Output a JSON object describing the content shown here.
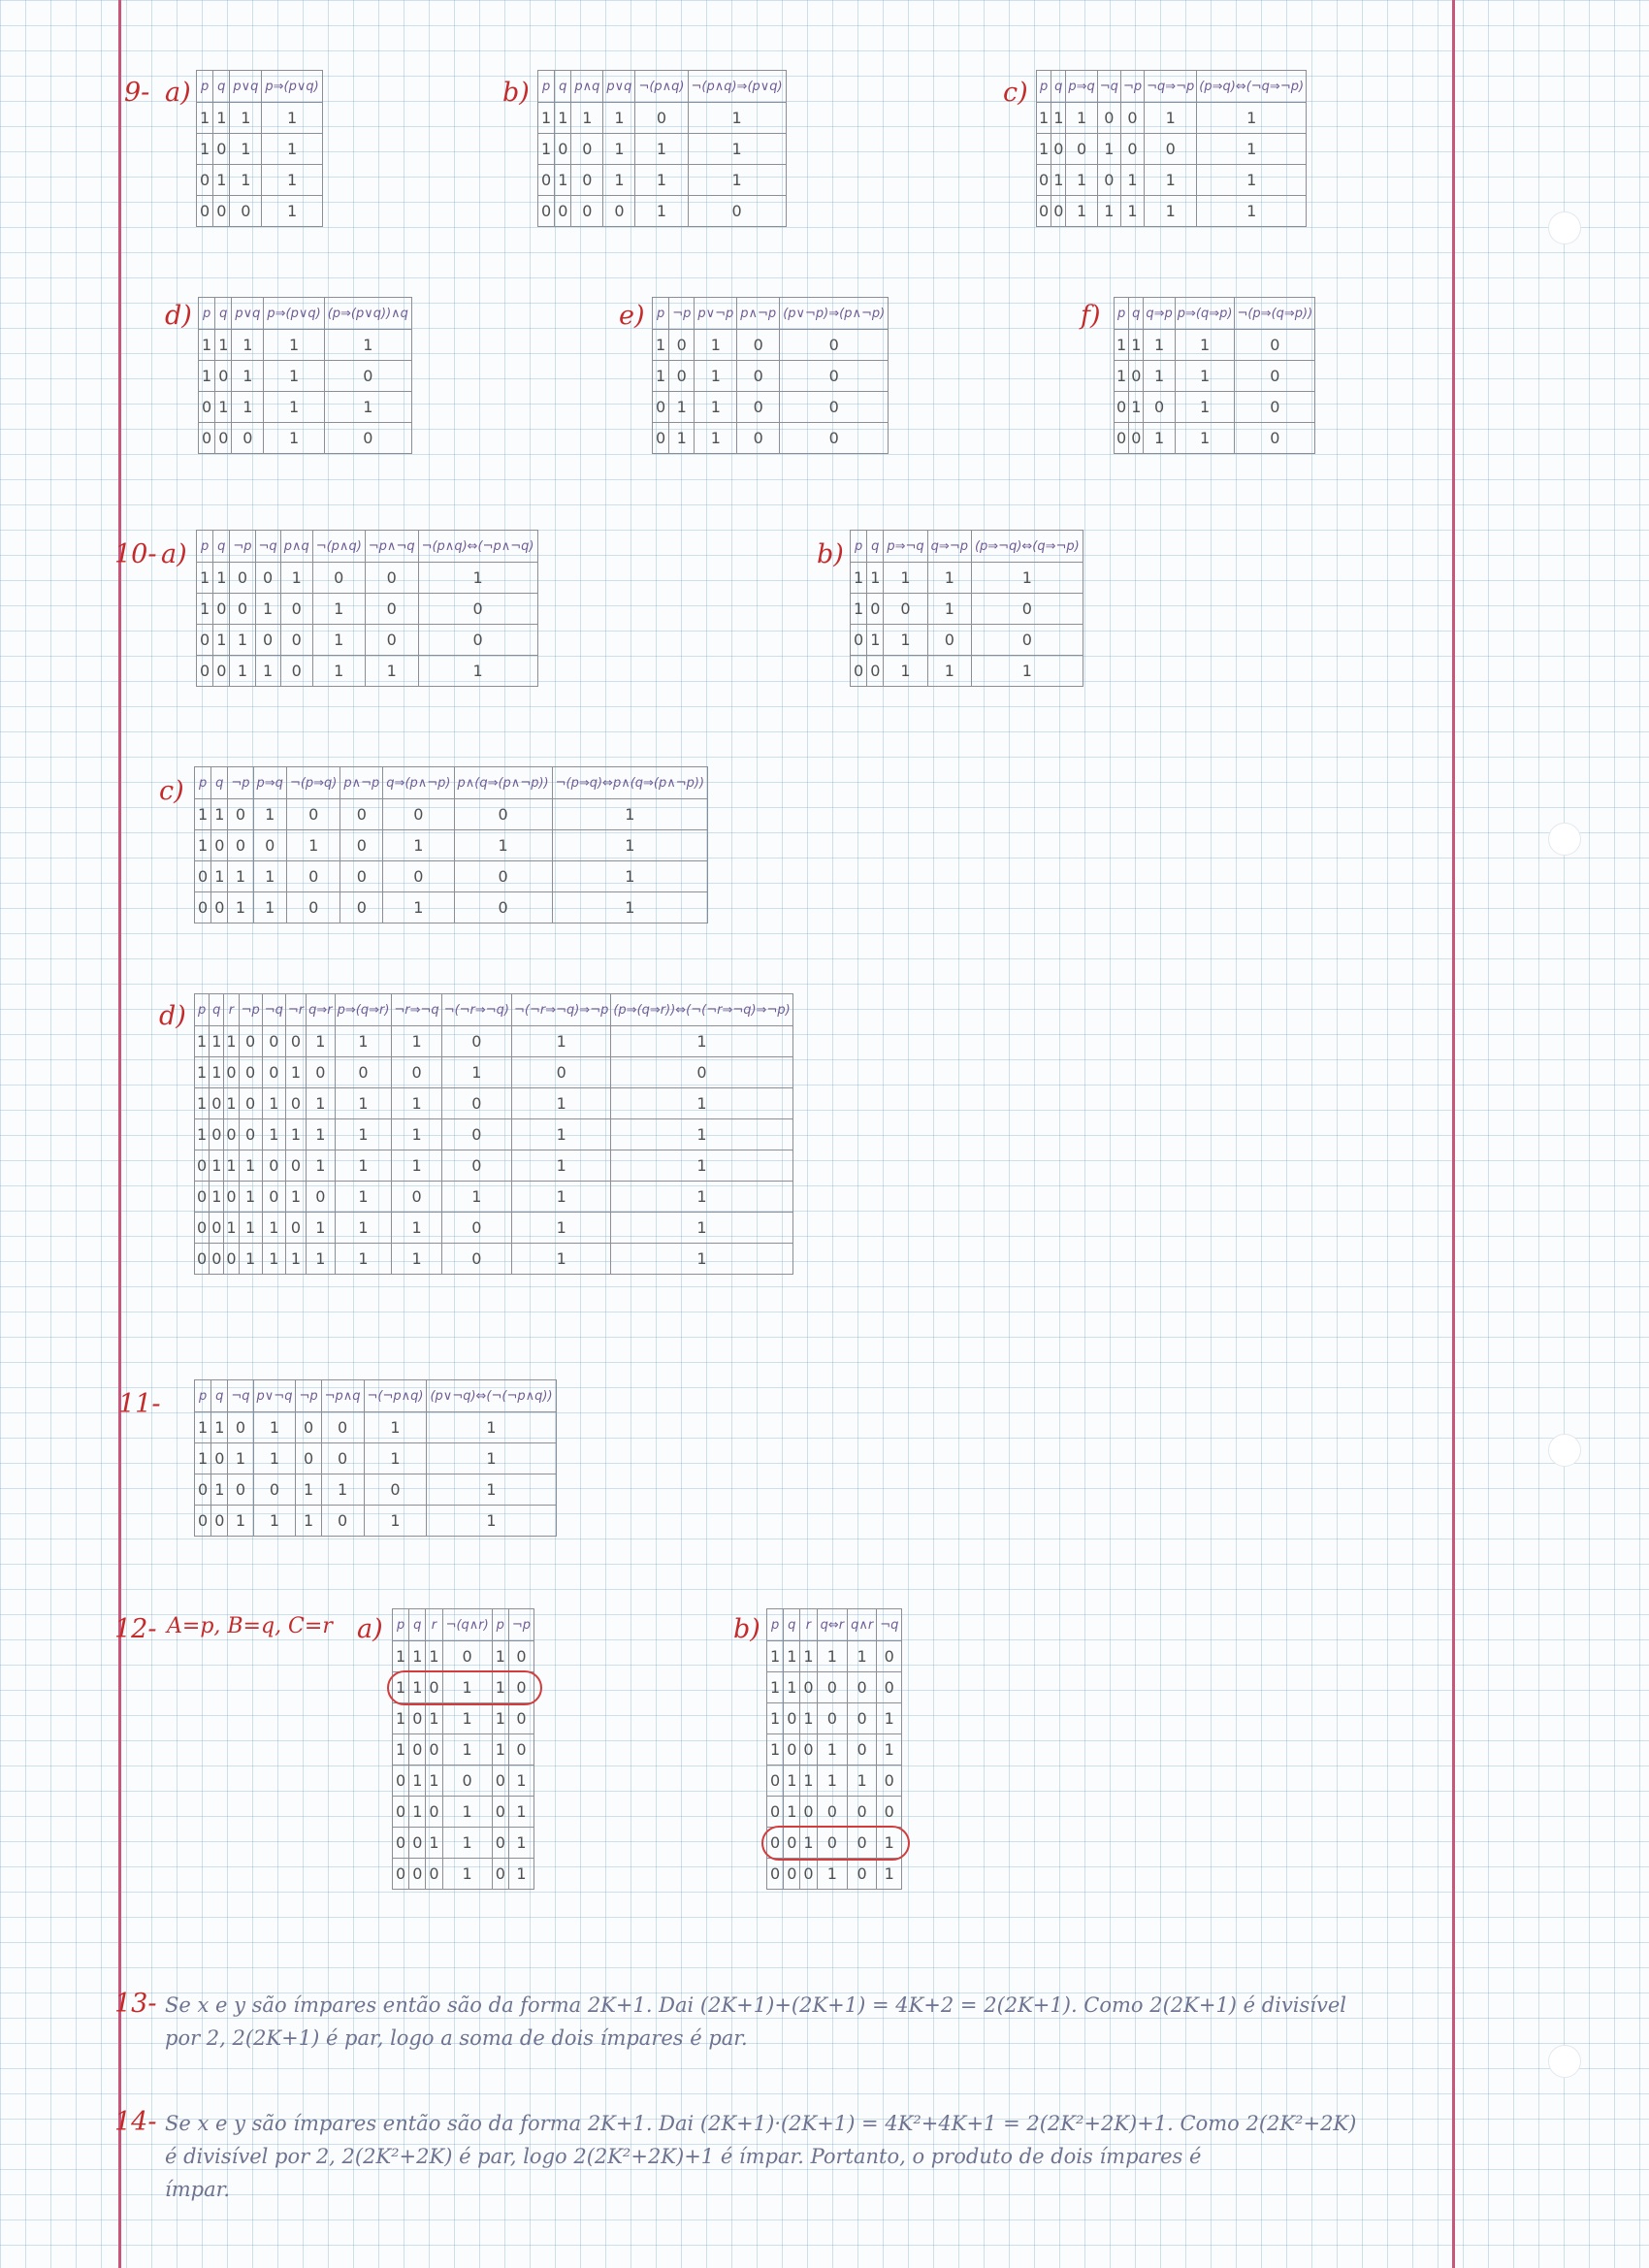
{
  "ex9": {
    "label": "9-",
    "a": {
      "label": "a)",
      "headers": [
        "p",
        "q",
        "p∨q",
        "p⇒(p∨q)"
      ],
      "rows": [
        [
          "1",
          "1",
          "1",
          "1"
        ],
        [
          "1",
          "0",
          "1",
          "1"
        ],
        [
          "0",
          "1",
          "1",
          "1"
        ],
        [
          "0",
          "0",
          "0",
          "1"
        ]
      ]
    },
    "b": {
      "label": "b)",
      "headers": [
        "p",
        "q",
        "p∧q",
        "p∨q",
        "¬(p∧q)",
        "¬(p∧q)⇒(p∨q)"
      ],
      "rows": [
        [
          "1",
          "1",
          "1",
          "1",
          "0",
          "1"
        ],
        [
          "1",
          "0",
          "0",
          "1",
          "1",
          "1"
        ],
        [
          "0",
          "1",
          "0",
          "1",
          "1",
          "1"
        ],
        [
          "0",
          "0",
          "0",
          "0",
          "1",
          "0"
        ]
      ]
    },
    "c": {
      "label": "c)",
      "headers": [
        "p",
        "q",
        "p⇒q",
        "¬q",
        "¬p",
        "¬q⇒¬p",
        "(p⇒q)⇔(¬q⇒¬p)"
      ],
      "rows": [
        [
          "1",
          "1",
          "1",
          "0",
          "0",
          "1",
          "1"
        ],
        [
          "1",
          "0",
          "0",
          "1",
          "0",
          "0",
          "1"
        ],
        [
          "0",
          "1",
          "1",
          "0",
          "1",
          "1",
          "1"
        ],
        [
          "0",
          "0",
          "1",
          "1",
          "1",
          "1",
          "1"
        ]
      ]
    },
    "d": {
      "label": "d)",
      "headers": [
        "p",
        "q",
        "p∨q",
        "p⇒(p∨q)",
        "(p⇒(p∨q))∧q"
      ],
      "rows": [
        [
          "1",
          "1",
          "1",
          "1",
          "1"
        ],
        [
          "1",
          "0",
          "1",
          "1",
          "0"
        ],
        [
          "0",
          "1",
          "1",
          "1",
          "1"
        ],
        [
          "0",
          "0",
          "0",
          "1",
          "0"
        ]
      ]
    },
    "e": {
      "label": "e)",
      "headers": [
        "p",
        "¬p",
        "p∨¬p",
        "p∧¬p",
        "(p∨¬p)⇒(p∧¬p)"
      ],
      "rows": [
        [
          "1",
          "0",
          "1",
          "0",
          "0"
        ],
        [
          "1",
          "0",
          "1",
          "0",
          "0"
        ],
        [
          "0",
          "1",
          "1",
          "0",
          "0"
        ],
        [
          "0",
          "1",
          "1",
          "0",
          "0"
        ]
      ]
    },
    "f": {
      "label": "f)",
      "headers": [
        "p",
        "q",
        "q⇒p",
        "p⇒(q⇒p)",
        "¬(p⇒(q⇒p))"
      ],
      "rows": [
        [
          "1",
          "1",
          "1",
          "1",
          "0"
        ],
        [
          "1",
          "0",
          "1",
          "1",
          "0"
        ],
        [
          "0",
          "1",
          "0",
          "1",
          "0"
        ],
        [
          "0",
          "0",
          "1",
          "1",
          "0"
        ]
      ]
    }
  },
  "ex10": {
    "label": "10-",
    "a": {
      "label": "a)",
      "headers": [
        "p",
        "q",
        "¬p",
        "¬q",
        "p∧q",
        "¬(p∧q)",
        "¬p∧¬q",
        "¬(p∧q)⇔(¬p∧¬q)"
      ],
      "rows": [
        [
          "1",
          "1",
          "0",
          "0",
          "1",
          "0",
          "0",
          "1"
        ],
        [
          "1",
          "0",
          "0",
          "1",
          "0",
          "1",
          "0",
          "0"
        ],
        [
          "0",
          "1",
          "1",
          "0",
          "0",
          "1",
          "0",
          "0"
        ],
        [
          "0",
          "0",
          "1",
          "1",
          "0",
          "1",
          "1",
          "1"
        ]
      ]
    },
    "b": {
      "label": "b)",
      "headers": [
        "p",
        "q",
        "p⇒¬q",
        "q⇒¬p",
        "(p⇒¬q)⇔(q⇒¬p)"
      ],
      "rows": [
        [
          "1",
          "1",
          "1",
          "1",
          "1"
        ],
        [
          "1",
          "0",
          "0",
          "1",
          "0"
        ],
        [
          "0",
          "1",
          "1",
          "0",
          "0"
        ],
        [
          "0",
          "0",
          "1",
          "1",
          "1"
        ]
      ]
    },
    "c": {
      "label": "c)",
      "headers": [
        "p",
        "q",
        "¬p",
        "p⇒q",
        "¬(p⇒q)",
        "p∧¬p",
        "q⇒(p∧¬p)",
        "p∧(q⇒(p∧¬p))",
        "¬(p⇒q)⇔p∧(q⇒(p∧¬p))"
      ],
      "rows": [
        [
          "1",
          "1",
          "0",
          "1",
          "0",
          "0",
          "0",
          "0",
          "1"
        ],
        [
          "1",
          "0",
          "0",
          "0",
          "1",
          "0",
          "1",
          "1",
          "1"
        ],
        [
          "0",
          "1",
          "1",
          "1",
          "0",
          "0",
          "0",
          "0",
          "1"
        ],
        [
          "0",
          "0",
          "1",
          "1",
          "0",
          "0",
          "1",
          "0",
          "1"
        ]
      ]
    },
    "d": {
      "label": "d)",
      "headers": [
        "p",
        "q",
        "r",
        "¬p",
        "¬q",
        "¬r",
        "q⇒r",
        "p⇒(q⇒r)",
        "¬r⇒¬q",
        "¬(¬r⇒¬q)",
        "¬(¬r⇒¬q)⇒¬p",
        "(p⇒(q⇒r))⇔(¬(¬r⇒¬q)⇒¬p)"
      ],
      "rows": [
        [
          "1",
          "1",
          "1",
          "0",
          "0",
          "0",
          "1",
          "1",
          "1",
          "0",
          "1",
          "1"
        ],
        [
          "1",
          "1",
          "0",
          "0",
          "0",
          "1",
          "0",
          "0",
          "0",
          "1",
          "0",
          "0"
        ],
        [
          "1",
          "0",
          "1",
          "0",
          "1",
          "0",
          "1",
          "1",
          "1",
          "0",
          "1",
          "1"
        ],
        [
          "1",
          "0",
          "0",
          "0",
          "1",
          "1",
          "1",
          "1",
          "1",
          "0",
          "1",
          "1"
        ],
        [
          "0",
          "1",
          "1",
          "1",
          "0",
          "0",
          "1",
          "1",
          "1",
          "0",
          "1",
          "1"
        ],
        [
          "0",
          "1",
          "0",
          "1",
          "0",
          "1",
          "0",
          "1",
          "0",
          "1",
          "1",
          "1"
        ],
        [
          "0",
          "0",
          "1",
          "1",
          "1",
          "0",
          "1",
          "1",
          "1",
          "0",
          "1",
          "1"
        ],
        [
          "0",
          "0",
          "0",
          "1",
          "1",
          "1",
          "1",
          "1",
          "1",
          "0",
          "1",
          "1"
        ]
      ]
    }
  },
  "ex11": {
    "label": "11-",
    "headers": [
      "p",
      "q",
      "¬q",
      "p∨¬q",
      "¬p",
      "¬p∧q",
      "¬(¬p∧q)",
      "(p∨¬q)⇔(¬(¬p∧q))"
    ],
    "rows": [
      [
        "1",
        "1",
        "0",
        "1",
        "0",
        "0",
        "1",
        "1"
      ],
      [
        "1",
        "0",
        "1",
        "1",
        "0",
        "0",
        "1",
        "1"
      ],
      [
        "0",
        "1",
        "0",
        "0",
        "1",
        "1",
        "0",
        "1"
      ],
      [
        "0",
        "0",
        "1",
        "1",
        "1",
        "0",
        "1",
        "1"
      ]
    ]
  },
  "ex12": {
    "label": "12-",
    "legend": "A=p, B=q, C=r",
    "a": {
      "label": "a)",
      "headers": [
        "p",
        "q",
        "r",
        "¬(q∧r)",
        "p",
        "¬p"
      ],
      "rows": [
        [
          "1",
          "1",
          "1",
          "0",
          "1",
          "0"
        ],
        [
          "1",
          "1",
          "0",
          "1",
          "1",
          "0"
        ],
        [
          "1",
          "0",
          "1",
          "1",
          "1",
          "0"
        ],
        [
          "1",
          "0",
          "0",
          "1",
          "1",
          "0"
        ],
        [
          "0",
          "1",
          "1",
          "0",
          "0",
          "1"
        ],
        [
          "0",
          "1",
          "0",
          "1",
          "0",
          "1"
        ],
        [
          "0",
          "0",
          "1",
          "1",
          "0",
          "1"
        ],
        [
          "0",
          "0",
          "0",
          "1",
          "0",
          "1"
        ]
      ],
      "highlight_row": 1
    },
    "b": {
      "label": "b)",
      "headers": [
        "p",
        "q",
        "r",
        "q⇔r",
        "q∧r",
        "¬q"
      ],
      "rows": [
        [
          "1",
          "1",
          "1",
          "1",
          "1",
          "0"
        ],
        [
          "1",
          "1",
          "0",
          "0",
          "0",
          "0"
        ],
        [
          "1",
          "0",
          "1",
          "0",
          "0",
          "1"
        ],
        [
          "1",
          "0",
          "0",
          "1",
          "0",
          "1"
        ],
        [
          "0",
          "1",
          "1",
          "1",
          "1",
          "0"
        ],
        [
          "0",
          "1",
          "0",
          "0",
          "0",
          "0"
        ],
        [
          "0",
          "0",
          "1",
          "0",
          "0",
          "1"
        ],
        [
          "0",
          "0",
          "0",
          "1",
          "0",
          "1"
        ]
      ],
      "highlight_row": 6
    }
  },
  "ex13": {
    "label": "13-",
    "lines": [
      "Se x e y são ímpares então são da forma 2K+1. Dai (2K+1)+(2K+1) = 4K+2 = 2(2K+1). Como 2(2K+1) é divisível",
      "por 2, 2(2K+1) é par, logo a soma de dois ímpares é par."
    ]
  },
  "ex14": {
    "label": "14-",
    "lines": [
      "Se x e y são ímpares então são da forma 2K+1. Dai (2K+1)·(2K+1) = 4K²+4K+1 = 2(2K²+2K)+1. Como 2(2K²+2K)",
      "é divisível por 2, 2(2K²+2K) é par, logo 2(2K²+2K)+1 é ímpar. Portanto, o produto de dois ímpares é",
      "ímpar."
    ]
  }
}
